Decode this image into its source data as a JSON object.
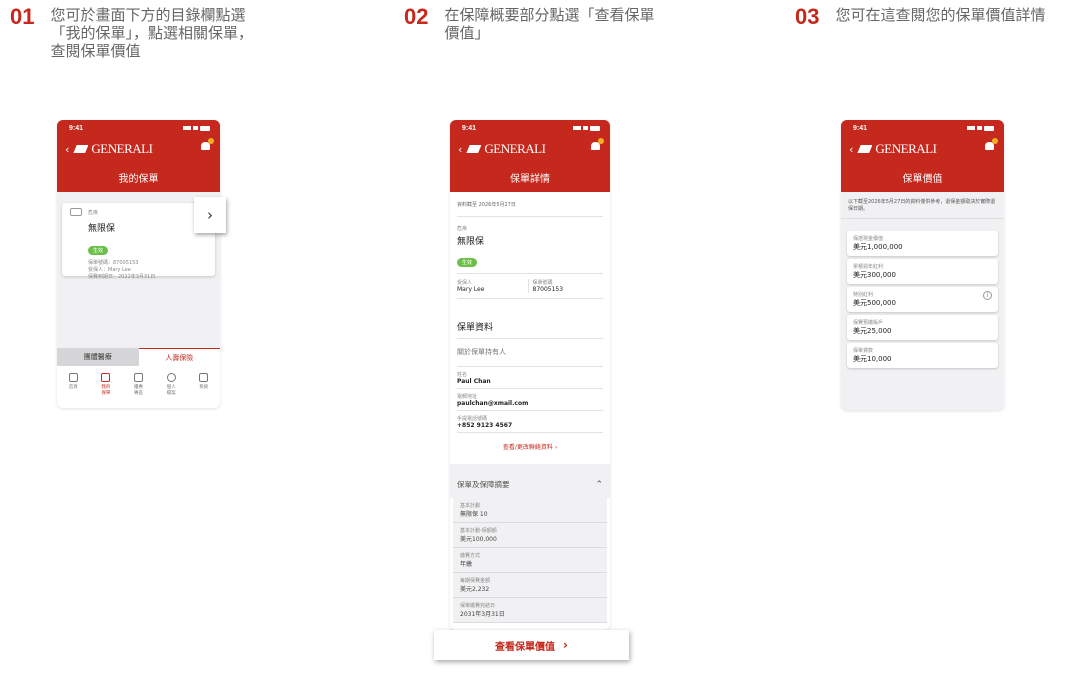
{
  "steps": [
    {
      "num": "01",
      "lines": [
        "您可於畫面下方的目錄欄點選",
        "「我的保單」，點選相關保單，",
        "查閱保單價值"
      ]
    },
    {
      "num": "02",
      "lines": [
        "在保障概要部分點選「查看保單",
        "價值」"
      ]
    },
    {
      "num": "03",
      "lines": [
        "您可在這查閱您的保單價值詳情"
      ]
    }
  ],
  "common": {
    "time": "9:41",
    "brand": "GENERALI"
  },
  "screen1": {
    "title": "我的保單",
    "card": {
      "type": "危疾",
      "name": "無限保",
      "status": "生效",
      "policy_no": "保單號碼：87005153",
      "insured": "受保人：Mary Lee",
      "due": "保費到期日：2022年3月31日"
    },
    "tabs": [
      "團體醫療",
      "人壽保險"
    ],
    "nav": [
      {
        "label": "首頁",
        "icon": "home-icon"
      },
      {
        "label": "我的\n保單",
        "icon": "policy-icon"
      },
      {
        "label": "優惠\n專區",
        "icon": "wallet-icon"
      },
      {
        "label": "個人\n檔案",
        "icon": "person-icon"
      },
      {
        "label": "系統",
        "icon": "chat-icon"
      }
    ]
  },
  "screen2": {
    "title": "保單詳情",
    "as_of": "資料截至 2026年5月27日",
    "type": "危疾",
    "name": "無限保",
    "status": "生效",
    "insured_label": "受保人",
    "insured": "Mary Lee",
    "policy_label": "保單號碼",
    "policy_no": "87005153",
    "section_title": "保單資料",
    "holder_title": "關於保單持有人",
    "fields": [
      {
        "label": "姓名",
        "value": "Paul Chan"
      },
      {
        "label": "電郵地址",
        "value": "paulchan@xmail.com"
      },
      {
        "label": "手提電話號碼",
        "value": "+852 9123 4567"
      }
    ],
    "edit_link": "查看/更改聯絡資料",
    "summary_title": "保單及保障摘要",
    "summary": [
      {
        "label": "基本計劃",
        "value": "無限保 10"
      },
      {
        "label": "基本計劃-保額額",
        "value": "美元100,000"
      },
      {
        "label": "繳費方式",
        "value": "年繳"
      },
      {
        "label": "每期保費金額",
        "value": "美元2,232"
      },
      {
        "label": "保單繳費完結日",
        "value": "2031年3月31日"
      }
    ],
    "view_button": "查看保單價值"
  },
  "screen3": {
    "title": "保單價值",
    "note": "以下截至2026年5月27日的資料僅供參考，退保金額取決於實際退保日期。",
    "values": [
      {
        "label": "保證現金價值",
        "value": "美元1,000,000"
      },
      {
        "label": "累積週年紅利",
        "value": "美元300,000"
      },
      {
        "label": "特別紅利",
        "value": "美元500,000"
      },
      {
        "label": "保費預繳賬戶",
        "value": "美元25,000"
      },
      {
        "label": "保單貸款",
        "value": "美元10,000"
      }
    ]
  }
}
